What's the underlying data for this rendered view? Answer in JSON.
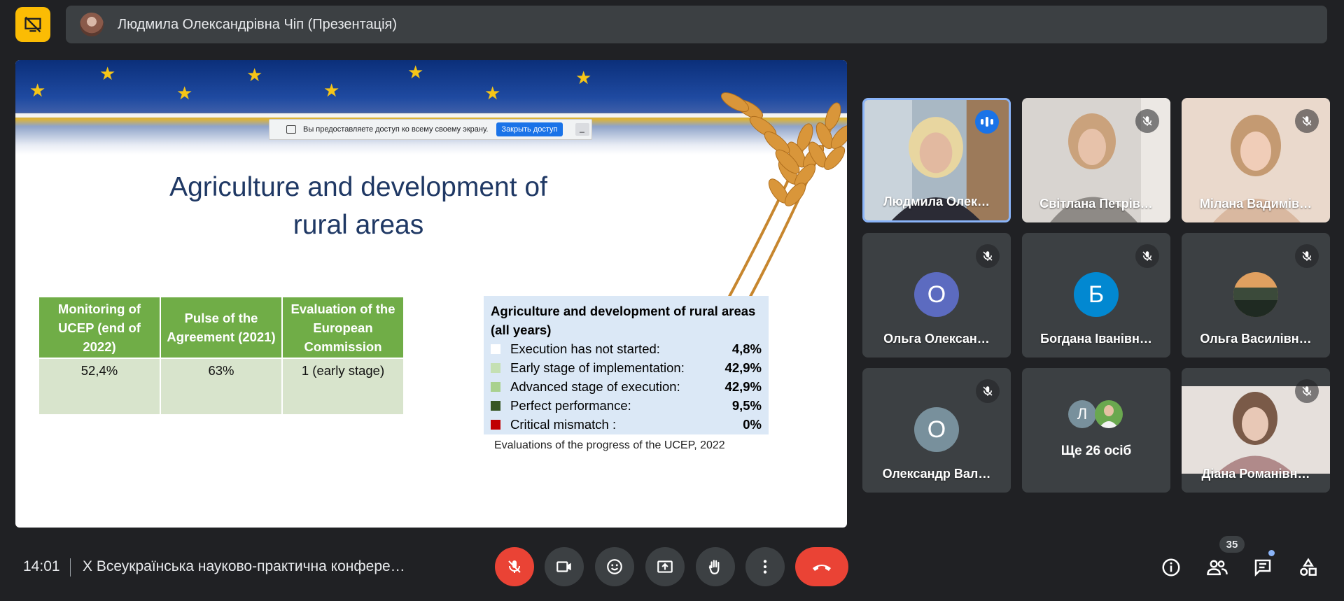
{
  "header": {
    "presenter_title": "Людмила Олександрівна Чіп (Презентація)"
  },
  "share_notice": {
    "text": "Вы предоставляете доступ ко всему своему экрану.",
    "stop_button": "Закрыть доступ",
    "minimize": "_"
  },
  "slide": {
    "title_line1": "Agriculture and development of",
    "title_line2": "rural areas",
    "table": {
      "headers": [
        "Monitoring of UCEP (end of 2022)",
        "Pulse of the Agreement (2021)",
        "Evaluation of the European Commission"
      ],
      "values": [
        "52,4%",
        "63%",
        "1 (early stage)"
      ]
    },
    "legend": {
      "title": "Agriculture and development of rural areas (all years)",
      "items": [
        {
          "label": "Execution has not started:",
          "value": "4,8%",
          "color": "#ffffff"
        },
        {
          "label": "Early stage of implementation:",
          "value": "42,9%",
          "color": "#c5e0b3"
        },
        {
          "label": "Advanced stage of execution:",
          "value": "42,9%",
          "color": "#a9d18e"
        },
        {
          "label": "Perfect performance:",
          "value": "9,5%",
          "color": "#375623"
        },
        {
          "label": "Critical mismatch :",
          "value": "0%",
          "color": "#c00000"
        }
      ],
      "caption": "Evaluations of the progress of the UCEP, 2022"
    }
  },
  "participants": {
    "p1": {
      "name": "Людмила Олек…"
    },
    "p2": {
      "name": "Світлана Петрів…"
    },
    "p3": {
      "name": "Мілана Вадимів…"
    },
    "p4": {
      "name": "Ольга Олексан…",
      "initial": "О"
    },
    "p5": {
      "name": "Богдана Іванівн…",
      "initial": "Б"
    },
    "p6": {
      "name": "Ольга Василівн…"
    },
    "p7": {
      "name": "Олександр Вал…",
      "initial": "О"
    },
    "p8": {
      "name": "Ще 26 осіб",
      "initial": "Л"
    },
    "p9": {
      "name": "Діана Романівн…"
    }
  },
  "bottom": {
    "time": "14:01",
    "meeting_title": "X Всеукраїнська науково-практична конфере…",
    "participant_count": "35"
  },
  "colors": {
    "accent_yellow": "#fbbc04",
    "end_call_red": "#ea4335",
    "active_blue": "#8ab4f8",
    "avatar_purple": "#5c6bc0",
    "avatar_blue": "#0288d1",
    "avatar_grey": "#78909c"
  }
}
